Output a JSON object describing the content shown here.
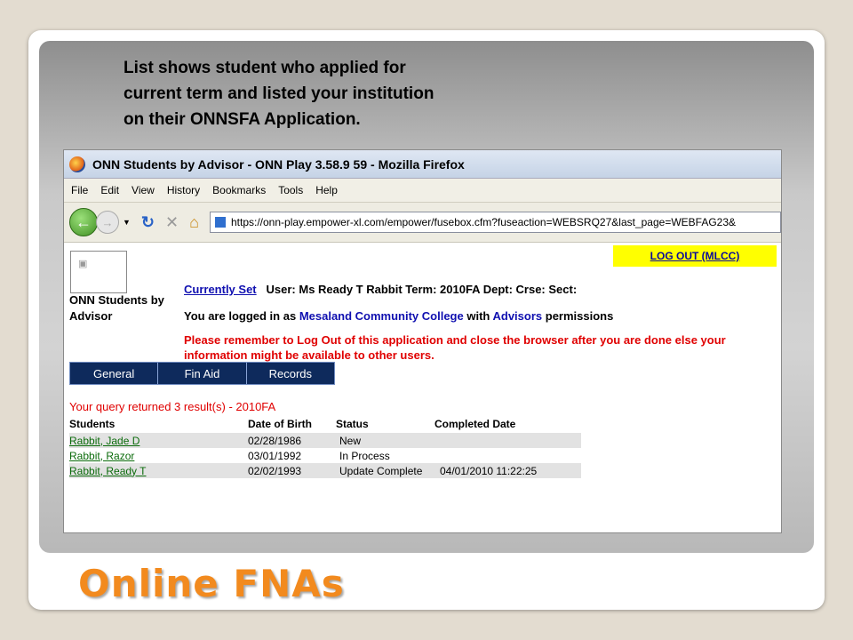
{
  "slide": {
    "caption_lines": [
      "List shows student who applied for",
      "current term and listed your institution",
      "on their ONNSFA Application."
    ],
    "title": "Online FNAs"
  },
  "browser": {
    "window_title": "ONN Students by Advisor - ONN Play 3.58.9 59 - Mozilla Firefox",
    "menu": [
      "File",
      "Edit",
      "View",
      "History",
      "Bookmarks",
      "Tools",
      "Help"
    ],
    "url": "https://onn-play.empower-xl.com/empower/fusebox.cfm?fuseaction=WEBSRQ27&last_page=WEBFAG23&"
  },
  "page": {
    "app_name": "ONN Students by Advisor",
    "logout_label": "LOG OUT (MLCC)",
    "currently_set": "Currently Set",
    "user_info": "User: Ms Ready T Rabbit  Term: 2010FA  Dept:  Crse:  Sect:",
    "logged_in_prefix": "You are logged in as",
    "institution": "Mesaland Community College",
    "logged_in_mid": "with",
    "role": "Advisors",
    "logged_in_suffix": "permissions",
    "warning": "Please remember to Log Out of this application and close the browser after you are done else your information might be available to other users.",
    "tabs": [
      "General",
      "Fin Aid",
      "Records"
    ],
    "query_result": "Your query returned 3 result(s) - 2010FA",
    "columns": [
      "Students",
      "Date of Birth",
      "Status",
      "Completed Date"
    ],
    "rows": [
      {
        "student": "Rabbit, Jade D",
        "dob": "02/28/1986",
        "status": "New",
        "completed": ""
      },
      {
        "student": "Rabbit, Razor",
        "dob": "03/01/1992",
        "status": "In Process",
        "completed": ""
      },
      {
        "student": "Rabbit, Ready T",
        "dob": "02/02/1993",
        "status": "Update Complete",
        "completed": "04/01/2010 11:22:25"
      }
    ]
  }
}
